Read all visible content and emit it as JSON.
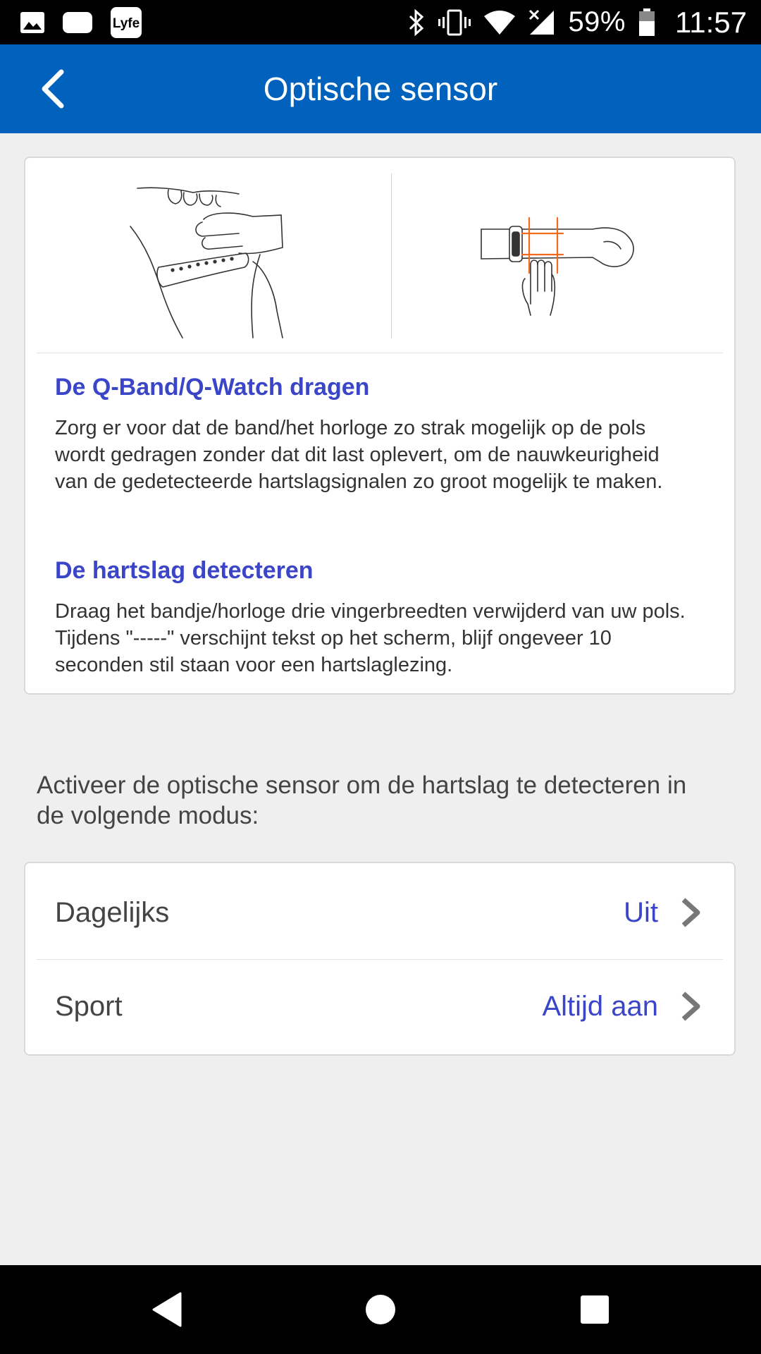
{
  "status_bar": {
    "battery": "59%",
    "time": "11:57",
    "icons": [
      "image-icon",
      "chat-icon",
      "lyfe-app-icon",
      "bluetooth-icon",
      "vibrate-icon",
      "wifi-icon",
      "signal-icon",
      "battery-icon"
    ]
  },
  "appbar": {
    "title": "Optische sensor",
    "back_icon": "back-arrow-icon"
  },
  "info": {
    "illustrations": [
      "wearing-band-illustration",
      "finger-width-illustration"
    ],
    "sections": [
      {
        "title": "De Q-Band/Q-Watch dragen",
        "body": "Zorg er voor dat de band/het horloge zo strak mogelijk op de pols wordt gedragen zonder dat dit last oplevert, om de nauwkeurigheid van de gedetecteerde hartslagsignalen zo groot mogelijk te maken."
      },
      {
        "title": "De hartslag detecteren",
        "body": "Draag het bandje/horloge drie vingerbreedten verwijderd van uw pols. Tijdens \"-----\" verschijnt tekst op het scherm, blijf ongeveer 10 seconden stil staan voor een hartslaglezing."
      }
    ]
  },
  "intro": "Activeer de optische sensor om de hartslag te detecteren in de volgende modus:",
  "modes": [
    {
      "label": "Dagelijks",
      "value": "Uit"
    },
    {
      "label": "Sport",
      "value": "Altijd aan"
    }
  ],
  "colors": {
    "appbar": "#0062bd",
    "accent": "#3a45c7",
    "illustration_highlight": "#f26b1d"
  },
  "navbar": {
    "icons": [
      "back-triangle-icon",
      "home-circle-icon",
      "recents-square-icon"
    ]
  }
}
